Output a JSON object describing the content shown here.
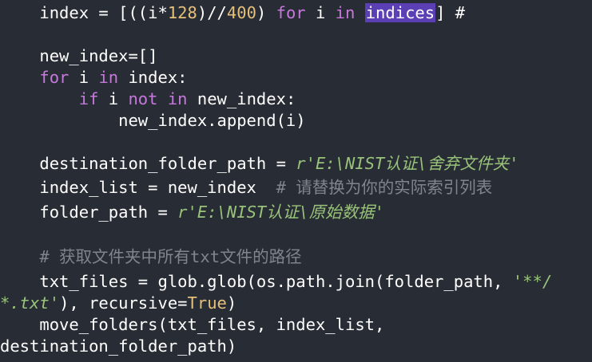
{
  "code": {
    "l1": {
      "p1": "    index = [((i*",
      "n128": "128",
      "p2": ")//",
      "n400": "400",
      "p3": ") ",
      "for": "for",
      "sp": " i ",
      "in": "in",
      "sp2": " ",
      "indices": "indices",
      "p4": "] #"
    },
    "l2": {
      "text": "    new_index=[]"
    },
    "l3": {
      "indent": "    ",
      "for": "for",
      "mid": " i ",
      "in": "in",
      "rest": " index:"
    },
    "l4": {
      "indent": "        ",
      "if": "if",
      "mid": " i ",
      "not": "not",
      "sp": " ",
      "in": "in",
      "rest": " new_index:"
    },
    "l5": {
      "text": "            new_index.append(i)"
    },
    "l6": {
      "pre": "    destination_folder_path = ",
      "str": "r'E:\\NIST认证\\舍弃文件夹'"
    },
    "l7": {
      "pre": "    index_list = new_index  ",
      "cmt": "# 请替换为你的实际索引列表"
    },
    "l8": {
      "pre": "    folder_path = ",
      "str": "r'E:\\NIST认证\\原始数据'"
    },
    "l9": {
      "cmt": "    # 获取文件夹中所有txt文件的路径"
    },
    "l10": {
      "pre": "    txt_files = glob.glob(os.path.join(folder_path, ",
      "str": "'**/"
    },
    "l11": {
      "str": "*.txt'",
      "mid": "), recursive=",
      "bool": "True",
      "end": ")"
    },
    "l12": {
      "text": "    move_folders(txt_files, index_list,"
    },
    "l13": {
      "text": "destination_folder_path)"
    }
  }
}
